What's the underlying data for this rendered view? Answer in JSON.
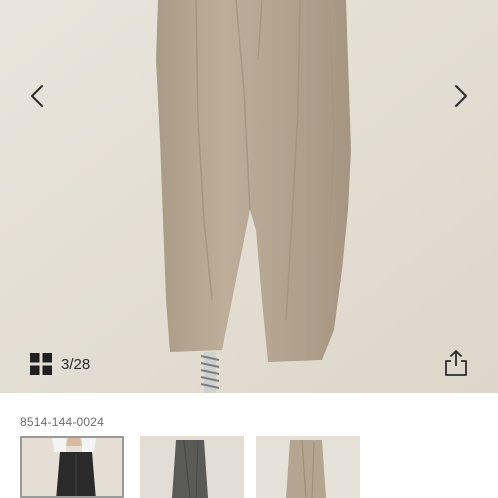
{
  "gallery": {
    "counter": "3/28",
    "accent_color": "#2b2b2b",
    "background_color": "#e6e1d8",
    "product_color": "#b7aa96",
    "icons": {
      "prev": "chevron-left-icon",
      "next": "chevron-right-icon",
      "grid": "grid-icon",
      "share": "share-icon"
    }
  },
  "product": {
    "sku": "8514-144-0024"
  },
  "thumbnails": [
    {
      "variant": "black",
      "selected": true
    },
    {
      "variant": "charcoal",
      "selected": false
    },
    {
      "variant": "beige",
      "selected": false
    }
  ]
}
